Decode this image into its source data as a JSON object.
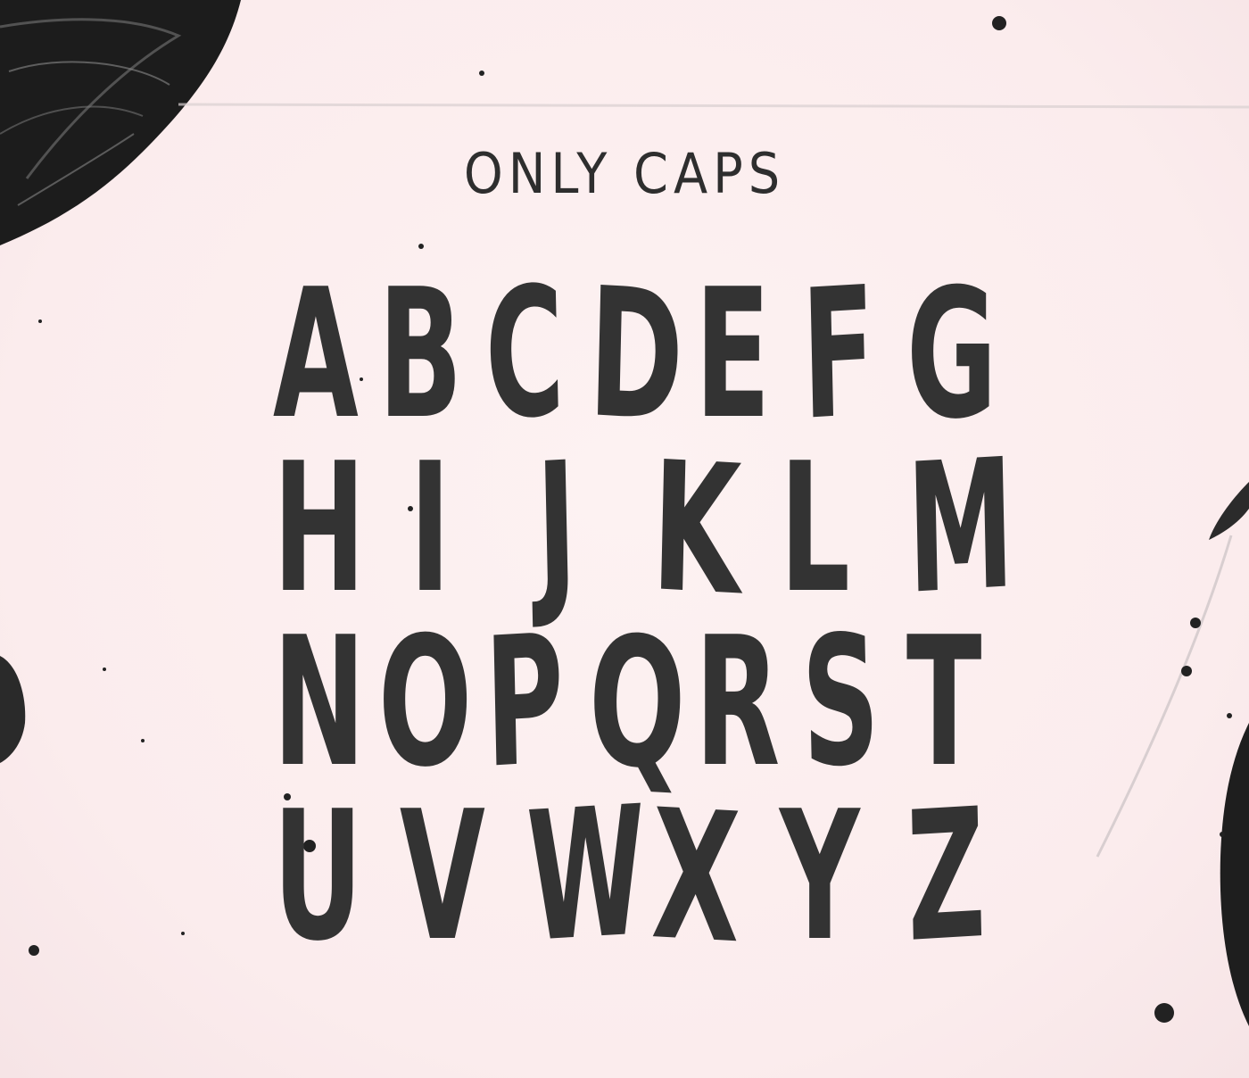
{
  "heading": "ONLY CAPS",
  "alphabet_rows": [
    [
      "A",
      "B",
      "C",
      "D",
      "E",
      "F",
      "G"
    ],
    [
      "H",
      "I",
      "J",
      "K",
      "L",
      "M"
    ],
    [
      "N",
      "O",
      "P",
      "Q",
      "R",
      "S",
      "T"
    ],
    [
      "U",
      "V",
      "W",
      "X",
      "Y",
      "Z"
    ]
  ],
  "colors": {
    "background": "#fbeeee",
    "ink": "#333333",
    "brush": "#1f1f1f"
  }
}
